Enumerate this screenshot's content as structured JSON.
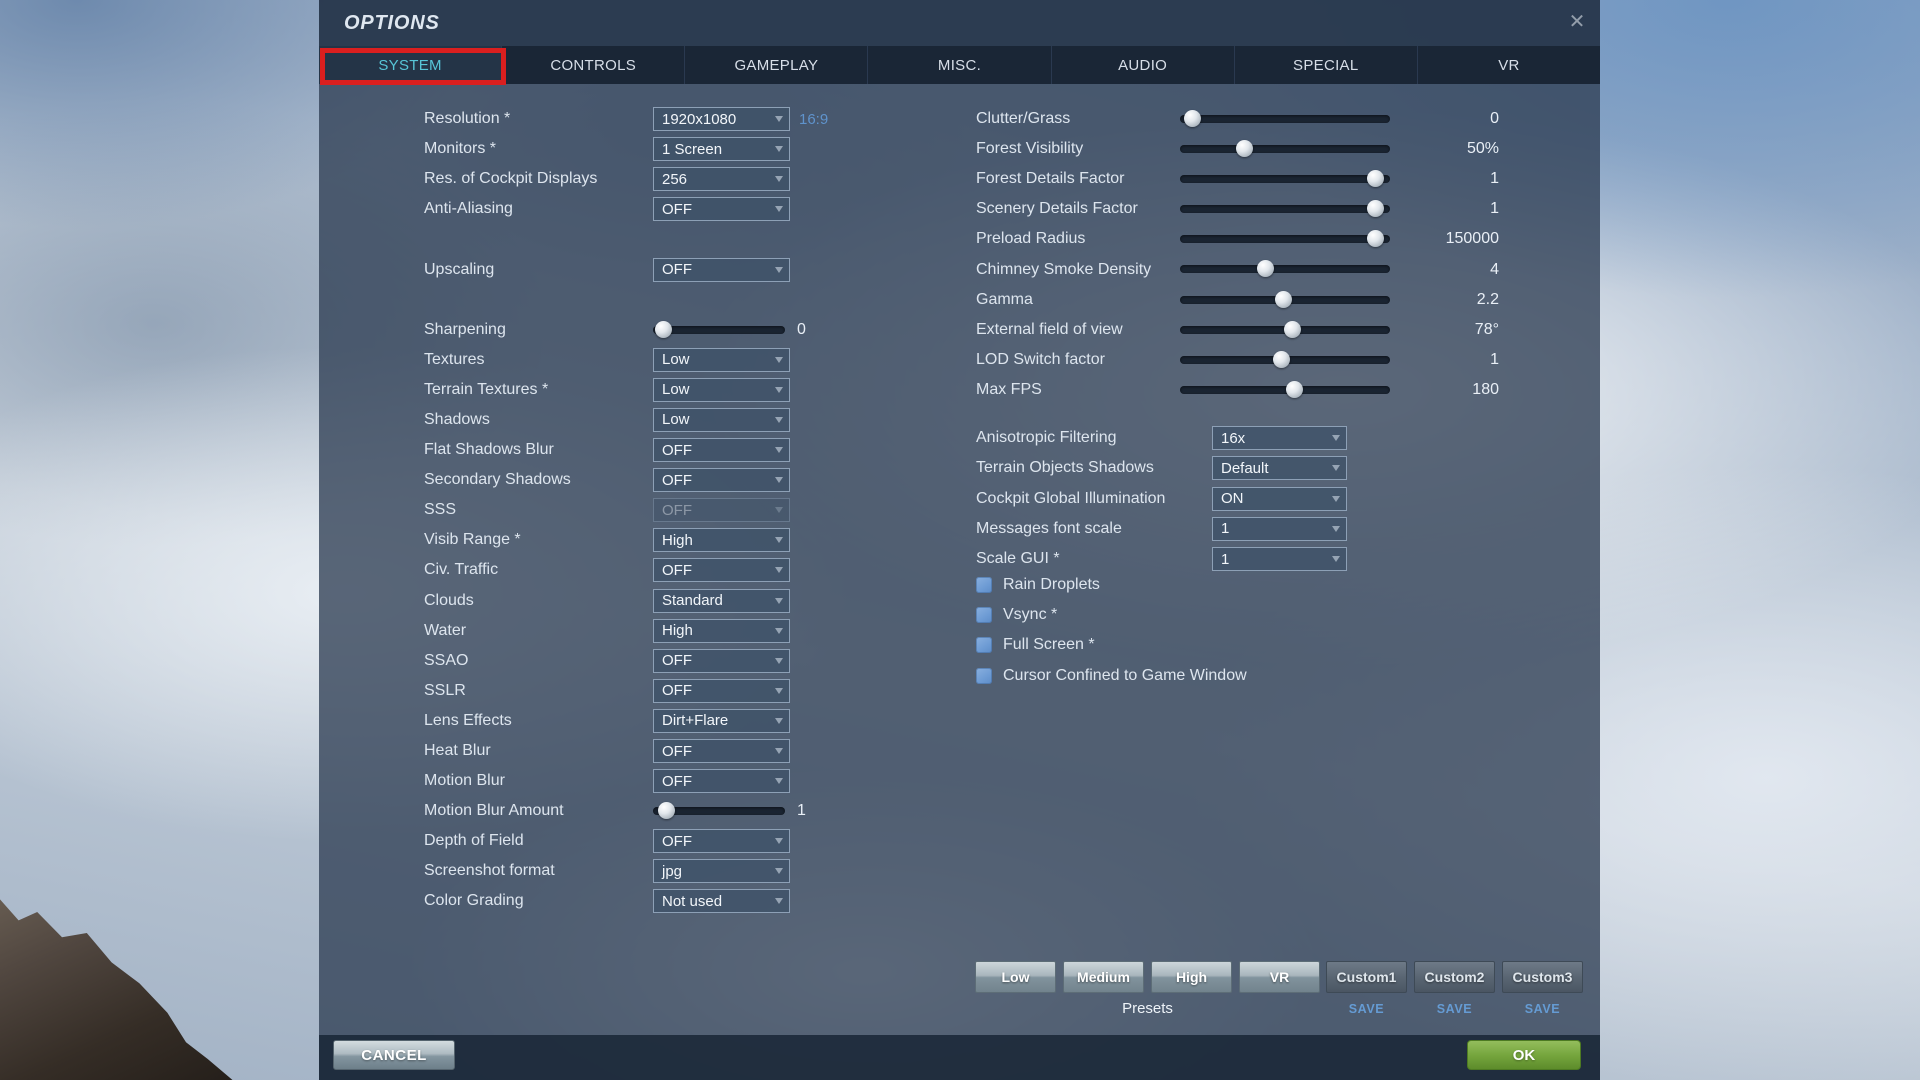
{
  "window": {
    "title": "OPTIONS",
    "close_icon": "✕"
  },
  "tabs": [
    {
      "label": "SYSTEM",
      "active": true
    },
    {
      "label": "CONTROLS",
      "active": false
    },
    {
      "label": "GAMEPLAY",
      "active": false
    },
    {
      "label": "MISC.",
      "active": false
    },
    {
      "label": "AUDIO",
      "active": false
    },
    {
      "label": "SPECIAL",
      "active": false
    },
    {
      "label": "VR",
      "active": false
    }
  ],
  "left_column": {
    "rows": [
      {
        "label": "Resolution *",
        "control": "dropdown",
        "value": "1920x1080",
        "extra": "16:9"
      },
      {
        "label": "Monitors *",
        "control": "dropdown",
        "value": "1 Screen"
      },
      {
        "label": "Res. of Cockpit Displays",
        "control": "dropdown",
        "value": "256"
      },
      {
        "label": "Anti-Aliasing",
        "control": "dropdown",
        "value": "OFF"
      },
      {
        "control": "gap"
      },
      {
        "label": "Upscaling",
        "control": "dropdown",
        "value": "OFF"
      },
      {
        "control": "gap"
      },
      {
        "label": "Sharpening",
        "control": "slider",
        "fraction": 0.02,
        "value": "0"
      },
      {
        "label": "Textures",
        "control": "dropdown",
        "value": "Low"
      },
      {
        "label": "Terrain Textures *",
        "control": "dropdown",
        "value": "Low"
      },
      {
        "label": "Shadows",
        "control": "dropdown",
        "value": "Low"
      },
      {
        "label": "Flat Shadows Blur",
        "control": "dropdown",
        "value": "OFF"
      },
      {
        "label": "Secondary Shadows",
        "control": "dropdown",
        "value": "OFF"
      },
      {
        "label": "SSS",
        "control": "dropdown",
        "value": "OFF",
        "disabled": true
      },
      {
        "label": "Visib Range *",
        "control": "dropdown",
        "value": "High"
      },
      {
        "label": "Civ. Traffic",
        "control": "dropdown",
        "value": "OFF"
      },
      {
        "label": "Clouds",
        "control": "dropdown",
        "value": "Standard"
      },
      {
        "label": "Water",
        "control": "dropdown",
        "value": "High"
      },
      {
        "label": "SSAO",
        "control": "dropdown",
        "value": "OFF"
      },
      {
        "label": "SSLR",
        "control": "dropdown",
        "value": "OFF"
      },
      {
        "label": "Lens Effects",
        "control": "dropdown",
        "value": "Dirt+Flare"
      },
      {
        "label": "Heat Blur",
        "control": "dropdown",
        "value": "OFF"
      },
      {
        "label": "Motion Blur",
        "control": "dropdown",
        "value": "OFF"
      },
      {
        "label": "Motion Blur Amount",
        "control": "slider",
        "fraction": 0.04,
        "value": "1"
      },
      {
        "label": "Depth of Field",
        "control": "dropdown",
        "value": "OFF"
      },
      {
        "label": "Screenshot format",
        "control": "dropdown",
        "value": "jpg"
      },
      {
        "label": "Color Grading",
        "control": "dropdown",
        "value": "Not used"
      }
    ]
  },
  "right_column": {
    "sliders": [
      {
        "label": "Clutter/Grass",
        "fraction": 0.02,
        "value": "0"
      },
      {
        "label": "Forest Visibility",
        "fraction": 0.29,
        "value": "50%"
      },
      {
        "label": "Forest Details Factor",
        "fraction": 0.97,
        "value": "1"
      },
      {
        "label": "Scenery Details Factor",
        "fraction": 0.97,
        "value": "1"
      },
      {
        "label": "Preload Radius",
        "fraction": 0.97,
        "value": "150000"
      },
      {
        "label": "Chimney Smoke Density",
        "fraction": 0.4,
        "value": "4"
      },
      {
        "label": "Gamma",
        "fraction": 0.49,
        "value": "2.2"
      },
      {
        "label": "External field of view",
        "fraction": 0.54,
        "value": "78°"
      },
      {
        "label": "LOD Switch factor",
        "fraction": 0.48,
        "value": "1"
      },
      {
        "label": "Max FPS",
        "fraction": 0.55,
        "value": "180"
      }
    ],
    "dropdowns": [
      {
        "label": "Anisotropic Filtering",
        "value": "16x"
      },
      {
        "label": "Terrain Objects Shadows",
        "value": "Default"
      },
      {
        "label": "Cockpit Global Illumination",
        "value": "ON"
      },
      {
        "label": "Messages font scale",
        "value": "1"
      },
      {
        "label": "Scale GUI *",
        "value": "1"
      }
    ],
    "checkboxes": [
      {
        "label": "Rain Droplets",
        "checked": false
      },
      {
        "label": "Vsync *",
        "checked": false
      },
      {
        "label": "Full Screen *",
        "checked": false
      },
      {
        "label": "Cursor Confined to Game Window",
        "checked": false
      }
    ]
  },
  "presets": {
    "label": "Presets",
    "buttons": [
      "Low",
      "Medium",
      "High",
      "VR"
    ],
    "custom_buttons": [
      {
        "label": "Custom1",
        "save": "SAVE"
      },
      {
        "label": "Custom2",
        "save": "SAVE"
      },
      {
        "label": "Custom3",
        "save": "SAVE"
      }
    ]
  },
  "footer": {
    "cancel": "CANCEL",
    "ok": "OK"
  },
  "annotation": {
    "type": "highlight-box",
    "color": "#da1f1f",
    "target_tab": "SYSTEM"
  },
  "colors": {
    "accent_teal": "#57c5d7",
    "link_blue": "#5f93cc",
    "ok_green": "#76a63e",
    "annotation_red": "#da1f1f"
  }
}
